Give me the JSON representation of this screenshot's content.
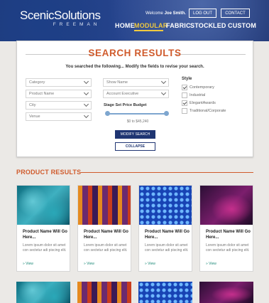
{
  "header": {
    "logo_main": "ScenicSolutions",
    "logo_sub": "FREEMAN",
    "welcome_prefix": "Welcome",
    "user_name": "Joe Smith.",
    "logout_label": "LOG OUT",
    "contact_label": "CONTACT",
    "nav": [
      "HOME",
      "MODULAR",
      "FABRIC",
      "STOCK",
      "LED",
      "CUSTOM"
    ],
    "active_nav": "MODULAR",
    "active_color": "#f0c93f"
  },
  "search": {
    "title": "SEARCH RESULTS",
    "subtitle": "You searched the following... Modify the fields to revise your search.",
    "selects": {
      "category": "Category",
      "product_name": "Product Name",
      "city": "City",
      "venue": "Venue",
      "show_name": "Show Name",
      "account_executive": "Account Executive"
    },
    "budget_label": "Stage Set Price Budget",
    "budget_range": "$0 to $45,240",
    "style_heading": "Style",
    "styles": [
      {
        "label": "Contemporary",
        "checked": true
      },
      {
        "label": "Industrial",
        "checked": false
      },
      {
        "label": "ElegantAwards",
        "checked": true
      },
      {
        "label": "Traditional/Corporate",
        "checked": false
      }
    ],
    "modify_label": "MODIFY SEARCH",
    "collapse_label": "COLLAPSE",
    "accent_color": "#d05b2c"
  },
  "products": {
    "title": "PRODUCT RESULTS",
    "items": [
      {
        "name": "Product Name Will Go Here...",
        "desc": "Lorem ipsum dolor sit amet con sectetur adi piscing elit.",
        "view": "» View"
      },
      {
        "name": "Product Name Will Go Here...",
        "desc": "Lorem ipsum dolor sit amet con sectetur adi piscing elit.",
        "view": "» View"
      },
      {
        "name": "Product Name Will Go Here...",
        "desc": "Lorem ipsum dolor sit amet con sectetur adi piscing elit.",
        "view": "» View"
      },
      {
        "name": "Product Name Will Go Here...",
        "desc": "Lorem ipsum dolor sit amet con sectetur adi piscing elit.",
        "view": "» View"
      }
    ]
  }
}
